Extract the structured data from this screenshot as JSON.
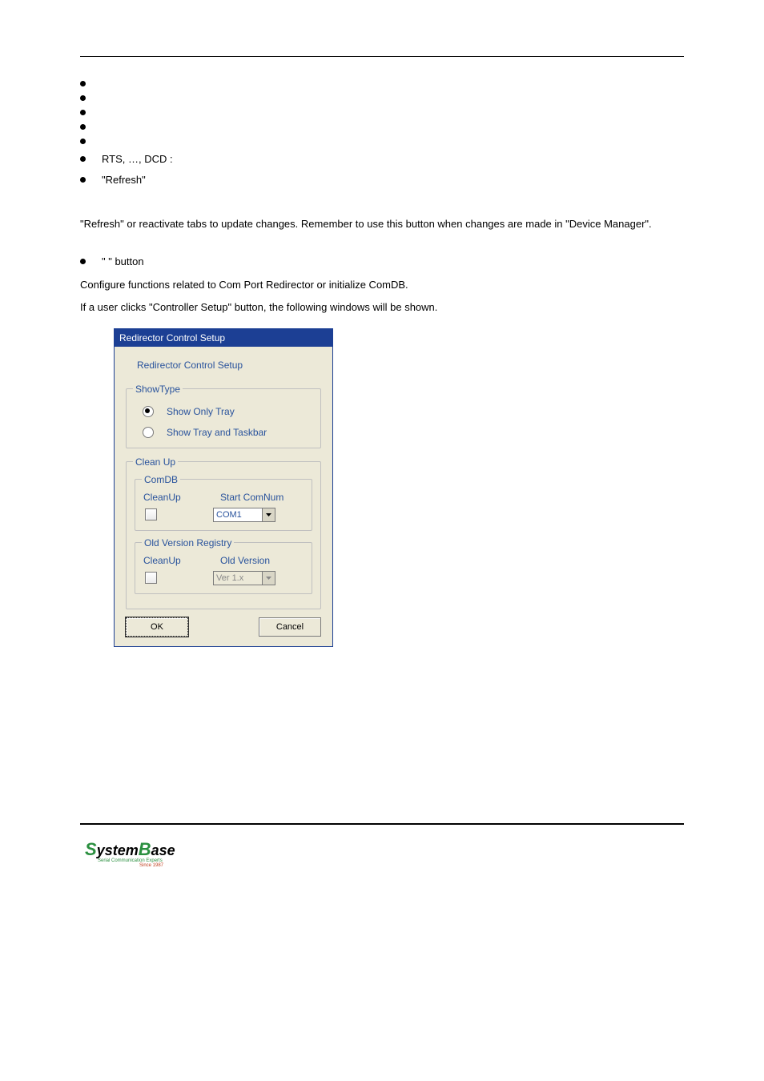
{
  "bullets": {
    "b1": "",
    "b2": "",
    "b3": "",
    "b4": "",
    "b5": "",
    "b6": "RTS, …, DCD :",
    "b7": "\"Refresh\""
  },
  "para1": "\"Refresh\" or reactivate tabs to update changes. Remember to use this button when changes are made in \"Device Manager\".",
  "bullet_button": "\"                         \" button",
  "config_line1": "Configure functions related to Com Port Redirector or initialize ComDB.",
  "config_line2": "If a user clicks   \"Controller Setup\"  button, the following windows will be shown.",
  "dialog": {
    "title": "Redirector Control Setup",
    "heading": "Redirector Control Setup",
    "showtype": {
      "legend": "ShowType",
      "opt1": "Show Only Tray",
      "opt2": "Show Tray and Taskbar"
    },
    "cleanup": {
      "legend": "Clean Up",
      "comdb": {
        "legend": "ComDB",
        "lbl_cleanup": "CleanUp",
        "lbl_startcom": "Start ComNum",
        "select_value": "COM1"
      },
      "oldver": {
        "legend": "Old Version Registry",
        "lbl_cleanup": "CleanUp",
        "lbl_oldver": "Old Version",
        "select_value": "Ver 1.x"
      }
    },
    "ok": "OK",
    "cancel": "Cancel"
  },
  "logo": {
    "part1": "S",
    "part2": "ystem",
    "part3": "B",
    "part4": "ase",
    "sub1": "Serial Communication Experts",
    "sub2": "Since 1987"
  }
}
